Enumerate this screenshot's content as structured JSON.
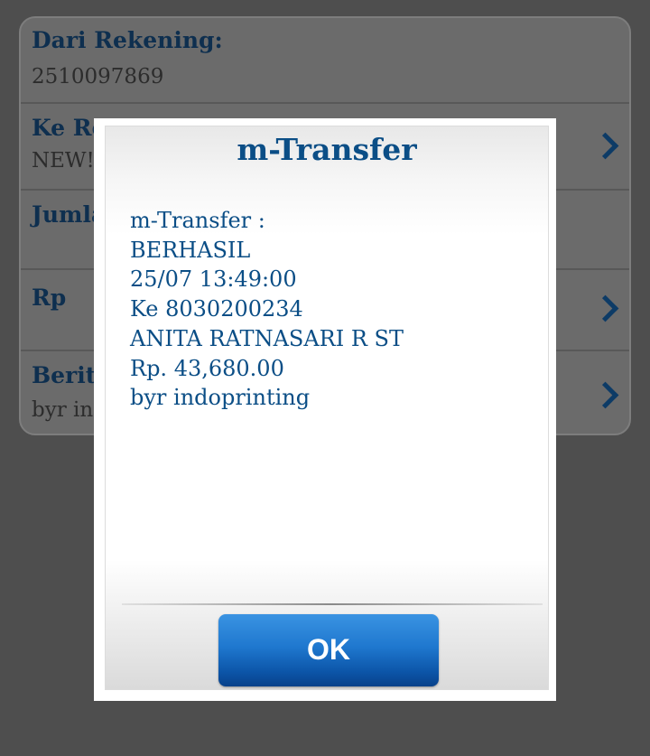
{
  "form": {
    "from_account": {
      "label": "Dari Rekening:",
      "value": "2510097869"
    },
    "to_account": {
      "label": "Ke Rekening",
      "value": "NEW!",
      "icon": "chevron-right-icon"
    },
    "amount": {
      "label": "Jumlah"
    },
    "currency": {
      "label": "Rp",
      "icon": "chevron-right-icon"
    },
    "message": {
      "label": "Berita",
      "value": "byr indoprinting",
      "icon": "chevron-right-icon"
    }
  },
  "modal": {
    "title": "m-Transfer",
    "lines": [
      "m-Transfer :",
      "BERHASIL",
      "25/07 13:49:00",
      "Ke 8030200234",
      "ANITA RATNASARI R ST",
      "Rp. 43,680.00",
      "byr indoprinting"
    ],
    "ok_label": "OK"
  },
  "colors": {
    "background": "#4e4e4e",
    "accent": "#0b4e86",
    "button": "#1f78cf"
  }
}
